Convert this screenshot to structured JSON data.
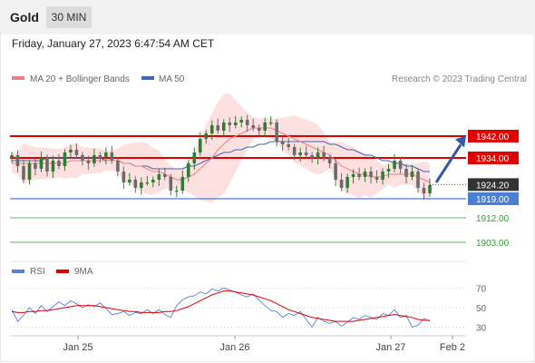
{
  "header": {
    "instrument": "Gold",
    "timeframe": "30 MIN"
  },
  "timestamp": "Friday, January 27, 2023 6:47:54 AM CET",
  "colors": {
    "up": "#2e7d32",
    "down": "#6b6b6b",
    "ma20": "#f08080",
    "bollinger_fill": "#fde0e0",
    "ma50": "#3f66b5",
    "resistance": "#e00000",
    "pivot": "#4a7fd6",
    "support": "#2e9e2e",
    "current": "#333333",
    "rsi": "#5b7fd6",
    "rsi_ma": "#e00000",
    "arrow": "#2f5aa8"
  },
  "chart_data": [
    {
      "type": "candlestick",
      "title": "Gold 30 MIN",
      "legend": {
        "position": "top-left",
        "items": [
          "MA 20 + Bollinger Bands",
          "MA 50"
        ]
      },
      "credit": "Research © 2023 Trading Central",
      "x_ticks": [
        "Jan 25",
        "Jan 26",
        "Jan 27",
        "Feb 2"
      ],
      "ylim": [
        1898,
        1960
      ],
      "current_price": "1924.20",
      "levels": [
        {
          "label": "1942.00",
          "value": 1942.0,
          "kind": "resistance"
        },
        {
          "label": "1934.00",
          "value": 1934.0,
          "kind": "resistance"
        },
        {
          "label": "1919.00",
          "value": 1919.0,
          "kind": "pivot"
        },
        {
          "label": "1912.00",
          "value": 1912.0,
          "kind": "support"
        },
        {
          "label": "1903.00",
          "value": 1903.0,
          "kind": "support"
        }
      ],
      "series": [
        {
          "name": "Close",
          "values": [
            1935,
            1931,
            1926,
            1932,
            1930,
            1934,
            1929,
            1933,
            1931,
            1936,
            1937,
            1935,
            1933,
            1932,
            1935,
            1934,
            1936,
            1933,
            1929,
            1925,
            1926,
            1923,
            1925,
            1925,
            1926,
            1928,
            1927,
            1922,
            1922,
            1927,
            1932,
            1936,
            1941,
            1943,
            1946,
            1944,
            1947,
            1946,
            1947,
            1948,
            1946,
            1945,
            1944,
            1947,
            1947,
            1940,
            1939,
            1938,
            1935,
            1936,
            1935,
            1934,
            1936,
            1934,
            1932,
            1926,
            1923,
            1927,
            1928,
            1927,
            1929,
            1927,
            1926,
            1929,
            1930,
            1933,
            1930,
            1927,
            1929,
            1923,
            1921,
            1924
          ]
        },
        {
          "name": "MA 20",
          "values": [
            1932,
            1932,
            1932,
            1932,
            1932,
            1932,
            1932,
            1932,
            1932,
            1932,
            1933,
            1933,
            1933,
            1933,
            1933,
            1933,
            1933,
            1933,
            1933,
            1932,
            1932,
            1931,
            1931,
            1930,
            1929,
            1929,
            1928,
            1927,
            1926,
            1926,
            1927,
            1928,
            1930,
            1932,
            1934,
            1937,
            1939,
            1941,
            1942,
            1943,
            1944,
            1945,
            1945,
            1945,
            1945,
            1944,
            1943,
            1942,
            1941,
            1940,
            1939,
            1938,
            1937,
            1936,
            1935,
            1933,
            1931,
            1930,
            1929,
            1928,
            1928,
            1927,
            1927,
            1927,
            1928,
            1928,
            1928,
            1928,
            1928,
            1927,
            1926,
            1925
          ]
        },
        {
          "name": "MA 50",
          "values": [
            1933,
            1933,
            1933,
            1933,
            1933,
            1933,
            1934,
            1934,
            1934,
            1934,
            1934,
            1934,
            1934,
            1934,
            1934,
            1934,
            1933,
            1933,
            1933,
            1932,
            1932,
            1931,
            1931,
            1931,
            1930,
            1930,
            1930,
            1930,
            1930,
            1930,
            1931,
            1931,
            1932,
            1933,
            1934,
            1935,
            1936,
            1936,
            1937,
            1937,
            1938,
            1938,
            1939,
            1939,
            1940,
            1940,
            1940,
            1940,
            1940,
            1940,
            1940,
            1940,
            1940,
            1940,
            1939,
            1939,
            1938,
            1937,
            1937,
            1936,
            1935,
            1935,
            1934,
            1933,
            1933,
            1932,
            1932,
            1931,
            1931,
            1930,
            1929,
            1929
          ]
        }
      ]
    },
    {
      "type": "line",
      "legend": {
        "position": "top-left",
        "items": [
          "RSI",
          "9MA"
        ]
      },
      "ylim": [
        25,
        75
      ],
      "y_ticks": [
        "70",
        "50",
        "30"
      ],
      "series": [
        {
          "name": "RSI",
          "values": [
            48,
            36,
            42,
            50,
            44,
            52,
            46,
            51,
            56,
            52,
            57,
            54,
            50,
            53,
            51,
            55,
            49,
            43,
            44,
            46,
            42,
            45,
            44,
            48,
            44,
            48,
            43,
            40,
            52,
            58,
            61,
            62,
            66,
            64,
            69,
            67,
            70,
            68,
            66,
            63,
            61,
            64,
            58,
            52,
            47,
            46,
            40,
            44,
            42,
            46,
            38,
            30,
            40,
            36,
            34,
            36,
            31,
            35,
            40,
            38,
            42,
            40,
            38,
            44,
            42,
            48,
            40,
            42,
            30,
            32,
            39,
            36
          ]
        },
        {
          "name": "9MA",
          "values": [
            46,
            45,
            45,
            46,
            46,
            47,
            47,
            48,
            49,
            50,
            51,
            52,
            52,
            52,
            52,
            51,
            50,
            49,
            48,
            47,
            46,
            46,
            45,
            45,
            45,
            45,
            46,
            46,
            47,
            49,
            51,
            54,
            57,
            60,
            63,
            65,
            67,
            67,
            66,
            65,
            64,
            63,
            61,
            59,
            57,
            54,
            51,
            48,
            46,
            44,
            42,
            40,
            39,
            38,
            37,
            36,
            36,
            36,
            36,
            37,
            38,
            39,
            40,
            41,
            42,
            43,
            42,
            41,
            40,
            38,
            37,
            37
          ]
        }
      ]
    }
  ]
}
